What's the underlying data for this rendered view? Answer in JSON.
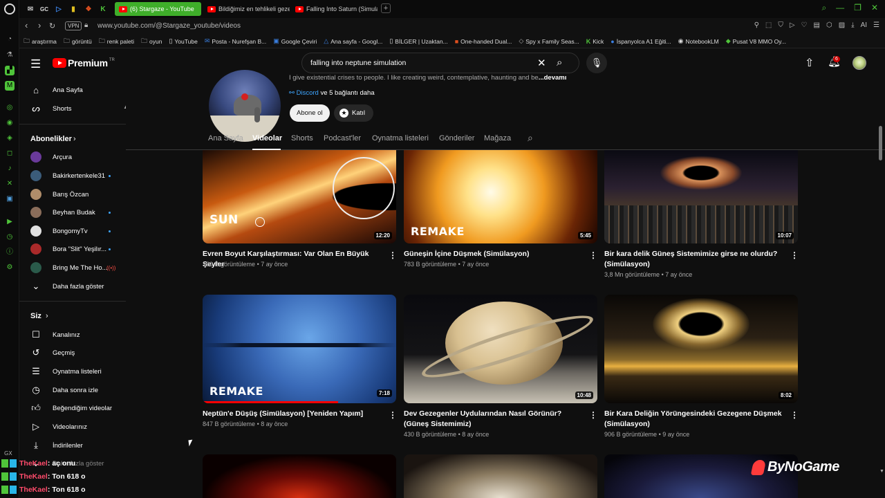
{
  "gx_rail": {
    "label": "GX"
  },
  "browser": {
    "pinned": [
      "GC"
    ],
    "tabs": [
      {
        "label": "(6) Stargaze - YouTube",
        "active": true
      },
      {
        "label": "Bildiğimiz en tehlikeli gezeg",
        "active": false
      },
      {
        "label": "Falling Into Saturn (Simulati",
        "active": false
      }
    ],
    "new_tab": "+",
    "address": {
      "vpn": "VPN",
      "url_host": "www.youtube.com",
      "url_path": "/@Stargaze_youtube/videos"
    },
    "bookmarks": [
      "araştırma",
      "görüntü",
      "renk paleti",
      "oyun",
      "YouTube",
      "Posta - Nurefşan B...",
      "Google Çeviri",
      "Ana sayfa - Googl...",
      "BİLGER | Uzaktan...",
      "One-handed Dual...",
      "Spy x Family Seas...",
      "Kick",
      "İspanyolca A1 Eğiti...",
      "NotebookLM",
      "Pusat V8 MMO Oy..."
    ],
    "ai_label": "AI"
  },
  "youtube": {
    "logo_text": "Premium",
    "logo_region": "TR",
    "search_value": "falling into neptune simulation",
    "notif_count": "6",
    "sidebar": {
      "main": [
        {
          "label": "Ana Sayfa",
          "icon": "home-icon"
        },
        {
          "label": "Shorts",
          "icon": "shorts-icon"
        }
      ],
      "subs_title": "Abonelikler",
      "subs": [
        {
          "label": "Arçura",
          "dot": false,
          "live": false,
          "color": "#6a3a9a"
        },
        {
          "label": "Bakirkertenkele31",
          "dot": true,
          "live": false,
          "color": "#3b5c7a"
        },
        {
          "label": "Barış Özcan",
          "dot": false,
          "live": false,
          "color": "#b08d6a"
        },
        {
          "label": "Beyhan Budak",
          "dot": true,
          "live": false,
          "color": "#8a6d5a"
        },
        {
          "label": "BongomyTv",
          "dot": true,
          "live": false,
          "color": "#e0e0e0"
        },
        {
          "label": "Bora \"Slit\" Yeşilır...",
          "dot": true,
          "live": false,
          "color": "#aa2a2a"
        },
        {
          "label": "Bring Me The Ho...",
          "dot": false,
          "live": true,
          "color": "#2a5a4a"
        }
      ],
      "show_more": "Daha fazla göster",
      "you_title": "Siz",
      "you": [
        {
          "label": "Kanalınız",
          "icon": "channel-icon"
        },
        {
          "label": "Geçmiş",
          "icon": "history-icon"
        },
        {
          "label": "Oynatma listeleri",
          "icon": "playlists-icon"
        },
        {
          "label": "Daha sonra izle",
          "icon": "watch-later-icon"
        },
        {
          "label": "Beğendiğim videolar",
          "icon": "liked-icon"
        },
        {
          "label": "Videolarınız",
          "icon": "your-videos-icon"
        },
        {
          "label": "İndirilenler",
          "icon": "download-icon"
        }
      ],
      "you_more": "Daha fazla göster"
    },
    "channel": {
      "description": "I give existential crises to people. I like creating weird, contemplative, haunting and be",
      "more": "...devamı",
      "link_name": "Discord",
      "link_more": "ve 5 bağlantı daha",
      "subscribe": "Abone ol",
      "join": "Katıl"
    },
    "tabs": [
      {
        "label": "Ana Sayfa",
        "active": false
      },
      {
        "label": "Videolar",
        "active": true
      },
      {
        "label": "Shorts",
        "active": false
      },
      {
        "label": "Podcast'ler",
        "active": false
      },
      {
        "label": "Oynatma listeleri",
        "active": false
      },
      {
        "label": "Gönderiler",
        "active": false
      },
      {
        "label": "Mağaza",
        "active": false
      }
    ],
    "videos": [
      {
        "title": "Evren Boyut Karşılaştırması: Var Olan En Büyük Şeyler",
        "views": "180 B görüntüleme",
        "age": "7 ay önce",
        "duration": "12:20",
        "overlay": "SUN"
      },
      {
        "title": "Güneşin İçine Düşmek (Simülasyon)",
        "views": "783 B görüntüleme",
        "age": "7 ay önce",
        "duration": "5:45",
        "overlay": "REMAKE"
      },
      {
        "title": "Bir kara delik Güneş Sistemimize girse ne olurdu? (Simülasyon)",
        "views": "3,8 Mn görüntüleme",
        "age": "7 ay önce",
        "duration": "10:07",
        "overlay": ""
      },
      {
        "title": "Neptün'e Düşüş (Simülasyon) [Yeniden Yapım]",
        "views": "847 B görüntüleme",
        "age": "8 ay önce",
        "duration": "7:18",
        "overlay": "REMAKE",
        "progress": 0.7
      },
      {
        "title": "Dev Gezegenler Uydularından Nasıl Görünür? (Güneş Sistemimiz)",
        "views": "430 B görüntüleme",
        "age": "8 ay önce",
        "duration": "10:48",
        "overlay": ""
      },
      {
        "title": "Bir Kara Deliğin Yörüngesindeki Gezegene Düşmek (Simülasyon)",
        "views": "906 B görüntüleme",
        "age": "9 ay önce",
        "duration": "8:02",
        "overlay": ""
      }
    ],
    "meta_sep": "•"
  },
  "overlay": {
    "watermark": "ByNoGame",
    "chat": [
      {
        "user": "TheKael",
        "msg": ": aç onu"
      },
      {
        "user": "TheKael",
        "msg": ": Ton 618 o"
      },
      {
        "user": "TheKael",
        "msg": ": Ton 618 o"
      }
    ]
  },
  "colors": {
    "tab_active": "#3fae2a",
    "youtube_red": "#ff0000",
    "link_blue": "#3ea6ff",
    "chat_user": "#ff4b6b"
  }
}
